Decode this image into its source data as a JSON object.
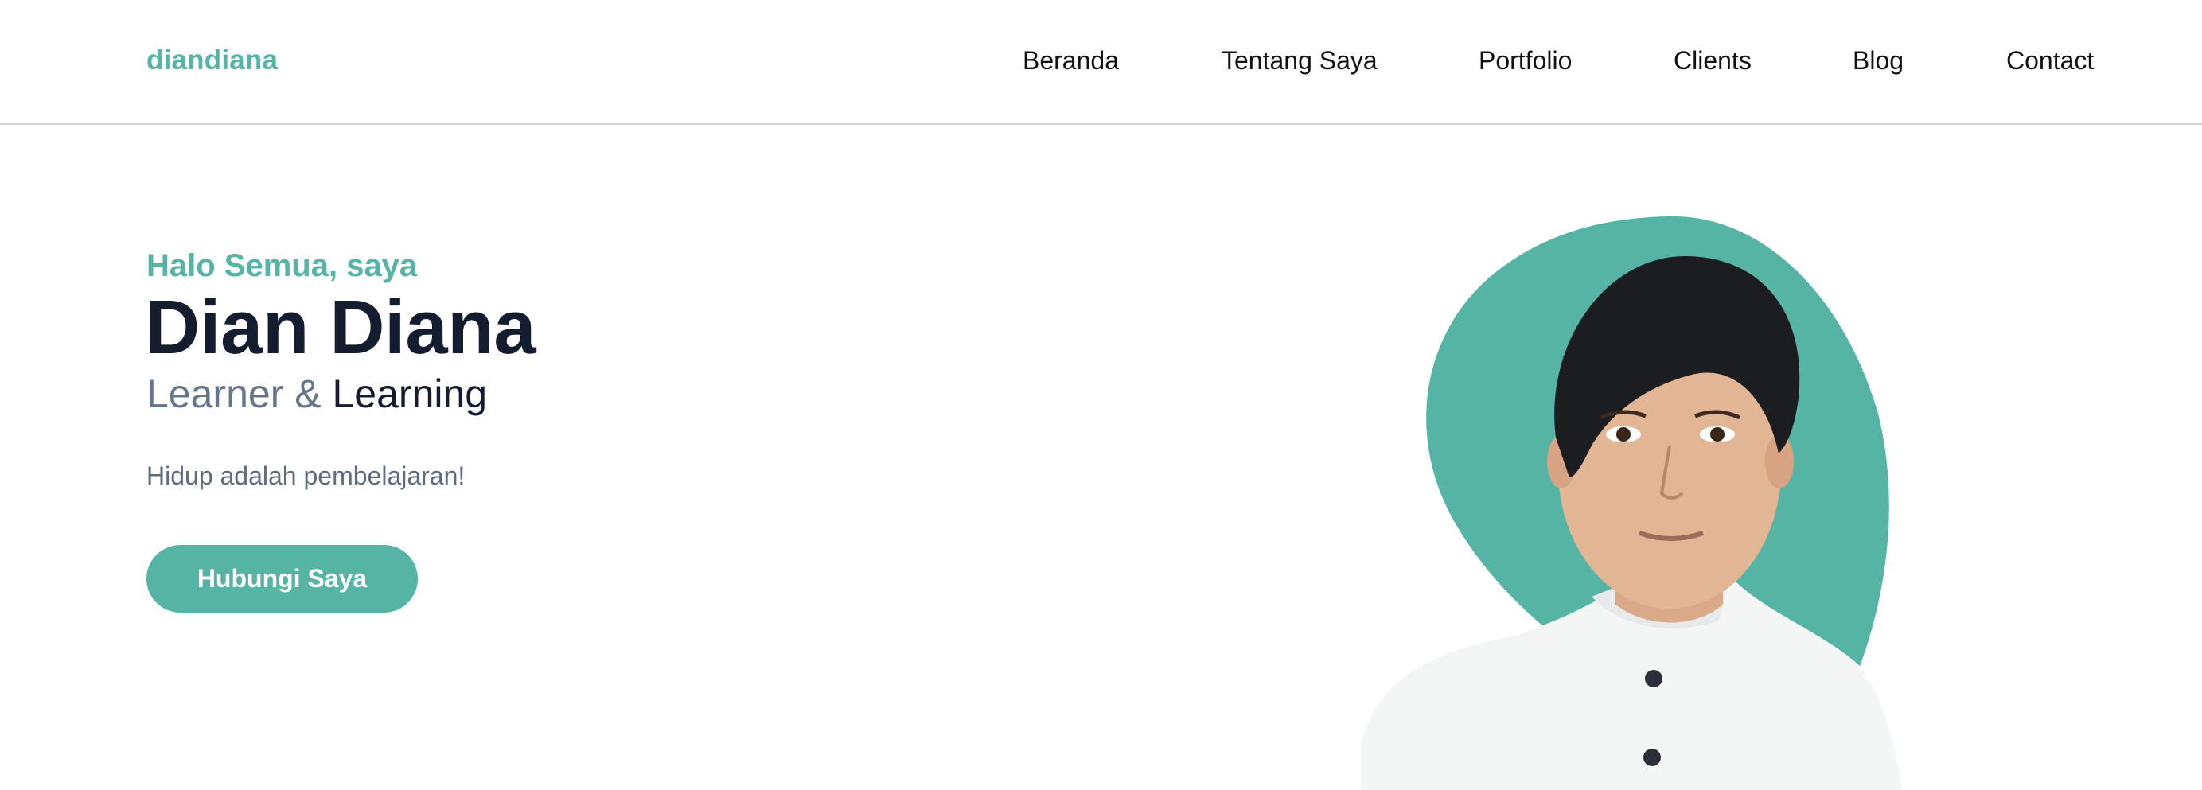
{
  "navbar": {
    "logo": "diandiana",
    "links": [
      {
        "label": "Beranda"
      },
      {
        "label": "Tentang Saya"
      },
      {
        "label": "Portfolio"
      },
      {
        "label": "Clients"
      },
      {
        "label": "Blog"
      },
      {
        "label": "Contact"
      }
    ]
  },
  "hero": {
    "greeting": "Halo Semua, saya",
    "name": "Dian Diana",
    "role_part1": "Learner &",
    "role_part2": "Learning",
    "tagline": "Hidup adalah pembelajaran!",
    "cta_label": "Hubungi Saya",
    "portrait_icon": "person-portrait-photo"
  },
  "colors": {
    "accent": "#55b4a4",
    "heading": "#141c30",
    "muted": "#66758a"
  }
}
